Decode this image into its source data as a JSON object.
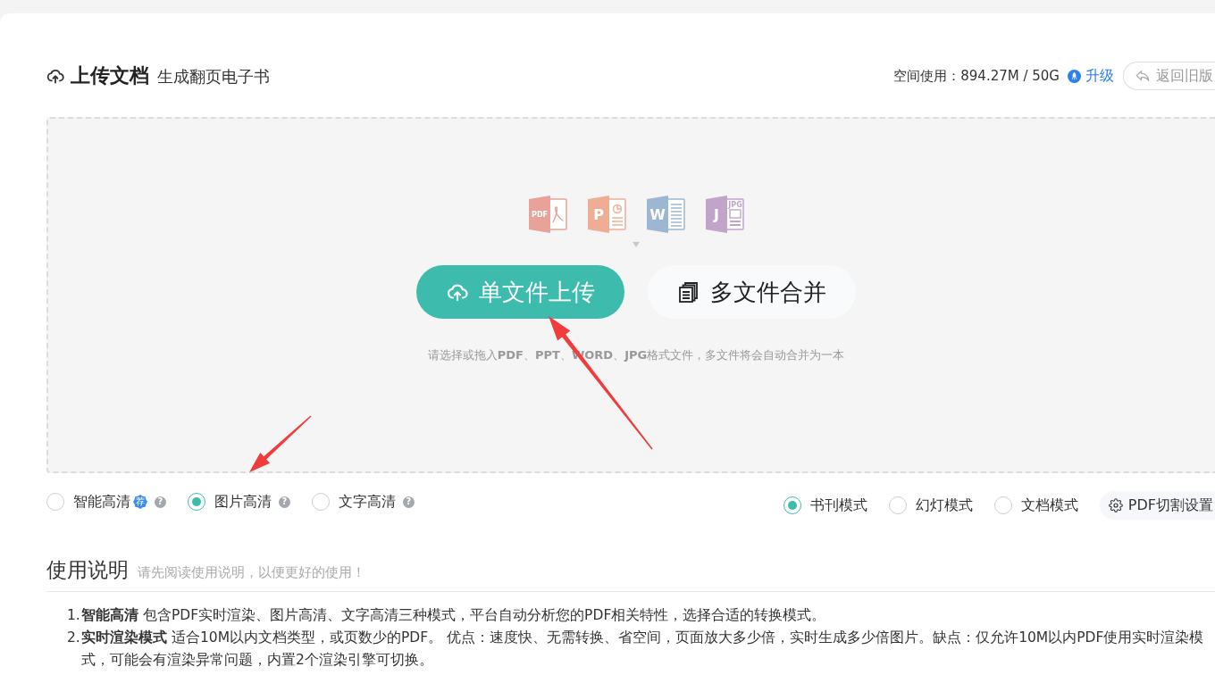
{
  "header": {
    "title": "上传文档",
    "subtitle": "生成翻页电子书",
    "storage": "空间使用：894.27M / 50G",
    "upgrade_link": "升级",
    "back_button": "返回旧版"
  },
  "upload_area": {
    "file_types": [
      {
        "kind": "pdf",
        "label": "PDF",
        "color": "#e9a299"
      },
      {
        "kind": "ppt",
        "label": "P",
        "color": "#efad95"
      },
      {
        "kind": "word",
        "label": "W",
        "color": "#9db7d3"
      },
      {
        "kind": "jpg",
        "label": "J",
        "sub_label": "JPG",
        "color": "#c1a5c9"
      }
    ],
    "buttons": [
      {
        "kind": "primary",
        "label": "单文件上传"
      },
      {
        "kind": "secondary",
        "label": "多文件合并"
      }
    ],
    "hint": "请选择或拖入**PDF**、**PPT**、**WORD**、**JPG**格式文件，多文件将会自动合并为一本"
  },
  "quality_modes": [
    {
      "label": "智能高清",
      "selected": false,
      "badge": "荐",
      "help": "?"
    },
    {
      "label": "图片高清",
      "selected": true,
      "help": "?"
    },
    {
      "label": "文字高清",
      "selected": false,
      "help": "?"
    }
  ],
  "view_modes": [
    {
      "label": "书刊模式",
      "selected": true
    },
    {
      "label": "幻灯模式",
      "selected": false
    },
    {
      "label": "文档模式",
      "selected": false
    }
  ],
  "settings_button": "PDF切割设置",
  "instructions": {
    "title": "使用说明",
    "subtitle": "请先阅读使用说明，以便更好的使用！",
    "items": [
      {
        "number": "1.",
        "text": "**智能高清** 包含PDF实时渲染、图片高清、文字高清三种模式，平台自动分析您的PDF相关特性，选择合适的转换模式。"
      },
      {
        "number": "2.",
        "text": "**实时渲染模式** 适合10M以内文档类型，或页数少的PDF。 优点：速度快、无需转换、省空间，页面放大多少倍，实时生成多少倍图片。缺点：仅允许10M以内PDF使用实时渲染模式，可能会有渲染异常问题，内置2个渲染引擎可切换。"
      }
    ]
  },
  "annotations": [
    {
      "kind": "arrow"
    },
    {
      "kind": "arrow"
    }
  ]
}
